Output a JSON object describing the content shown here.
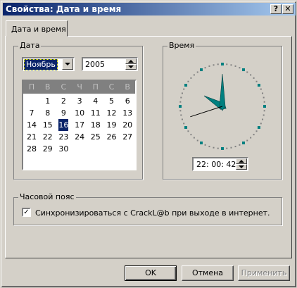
{
  "window": {
    "title": "Свойства: Дата и время",
    "help_label": "?",
    "close_label": "✕"
  },
  "tab": {
    "label": "Дата и время"
  },
  "date_group": {
    "label": "Дата",
    "month": "Ноябрь",
    "year": "2005",
    "weekdays": [
      "П",
      "В",
      "С",
      "Ч",
      "П",
      "С",
      "В"
    ],
    "weeks": [
      [
        "",
        "1",
        "2",
        "3",
        "4",
        "5",
        "6"
      ],
      [
        "7",
        "8",
        "9",
        "10",
        "11",
        "12",
        "13"
      ],
      [
        "14",
        "15",
        "16",
        "17",
        "18",
        "19",
        "20"
      ],
      [
        "21",
        "22",
        "23",
        "24",
        "25",
        "26",
        "27"
      ],
      [
        "28",
        "29",
        "30",
        "",
        "",
        "",
        ""
      ]
    ],
    "selected_day": "16"
  },
  "time_group": {
    "label": "Время",
    "time": "22: 00: 42",
    "clock": {
      "hour": 22,
      "minute": 0,
      "second": 42
    }
  },
  "timezone_group": {
    "label": "Часовой пояс",
    "sync_checked": true,
    "sync_label": "Синхронизироваться с CrackL@b при выходе в интернет."
  },
  "buttons": {
    "ok": "OK",
    "cancel": "Отмена",
    "apply": "Применить"
  },
  "colors": {
    "title_start": "#0a246a",
    "title_end": "#a6caf0",
    "face": "#d4d0c8",
    "clock_hand": "#008080",
    "selection": "#0a246a"
  }
}
